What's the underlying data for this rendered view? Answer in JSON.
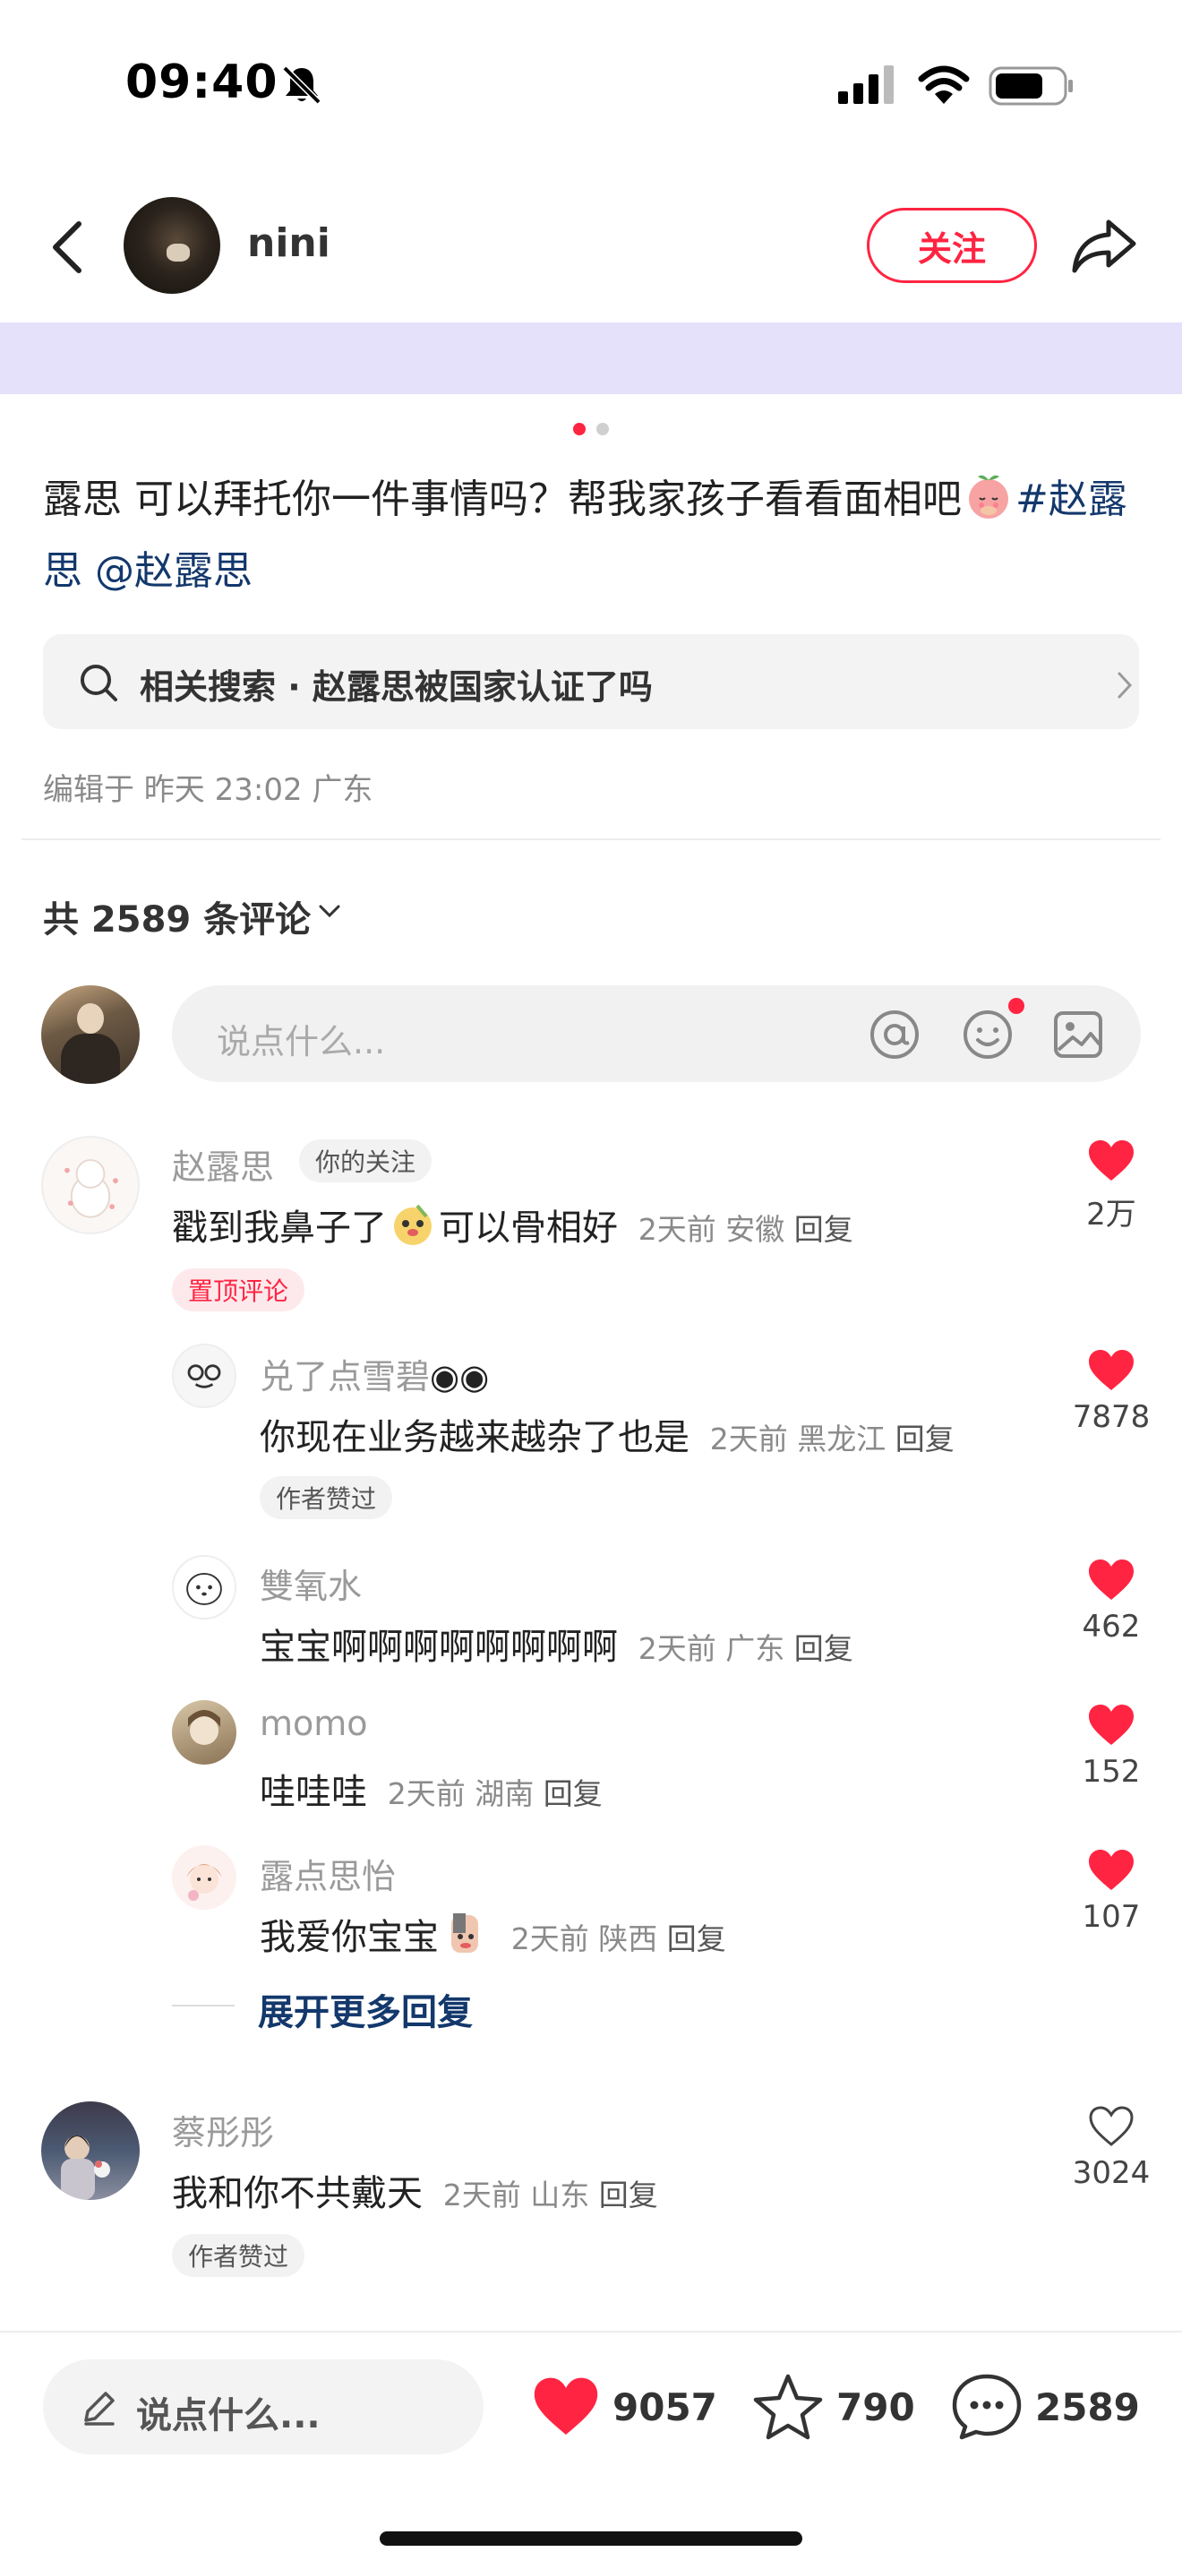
{
  "status_bar": {
    "time": "09:40"
  },
  "header": {
    "author": "nini",
    "follow_label": "关注"
  },
  "post": {
    "text": "露思 可以拜托你一件事情吗？帮我家孩子看看面相吧",
    "tag_prefix": "#",
    "tag": "赵露思",
    "mention": "@赵露思"
  },
  "related_search": "相关搜索 · 赵露思被国家认证了吗",
  "edit_info": "编辑于 昨天 23:02 广东",
  "comment_count": "共 2589 条评论",
  "comment_input_placeholder": "说点什么...",
  "comments": [
    {
      "name": "赵露思",
      "badge": "你的关注",
      "text_before": "戳到我鼻子了",
      "text_after": "可以骨相好",
      "time": "2天前",
      "location": "安徽",
      "reply": "回复",
      "likes": "2万",
      "liked": true,
      "pin_label": "置顶评论"
    },
    {
      "name": "兑了点雪碧",
      "text": "你现在业务越来越杂了也是",
      "time": "2天前",
      "location": "黑龙江",
      "reply": "回复",
      "likes": "7878",
      "liked": true,
      "author_liked_label": "作者赞过"
    },
    {
      "name": "雙氧水",
      "text": "宝宝啊啊啊啊啊啊啊啊",
      "time": "2天前",
      "location": "广东",
      "reply": "回复",
      "likes": "462",
      "liked": true
    },
    {
      "name": "momo",
      "text": "哇哇哇",
      "time": "2天前",
      "location": "湖南",
      "reply": "回复",
      "likes": "152",
      "liked": true
    },
    {
      "name": "露点思怡",
      "text": "我爱你宝宝",
      "time": "2天前",
      "location": "陕西",
      "reply": "回复",
      "likes": "107",
      "liked": true
    },
    {
      "name": "蔡彤彤",
      "text": "我和你不共戴天",
      "time": "2天前",
      "location": "山东",
      "reply": "回复",
      "likes": "3024",
      "liked": false,
      "author_liked_label": "作者赞过"
    }
  ],
  "expand_more": "展开更多回复",
  "bottom_bar": {
    "placeholder": "说点什么...",
    "likes": "9057",
    "collects": "790",
    "comments": "2589"
  },
  "colors": {
    "accent": "#ff2442",
    "link": "#13386c",
    "banner": "#e5e1fb"
  }
}
